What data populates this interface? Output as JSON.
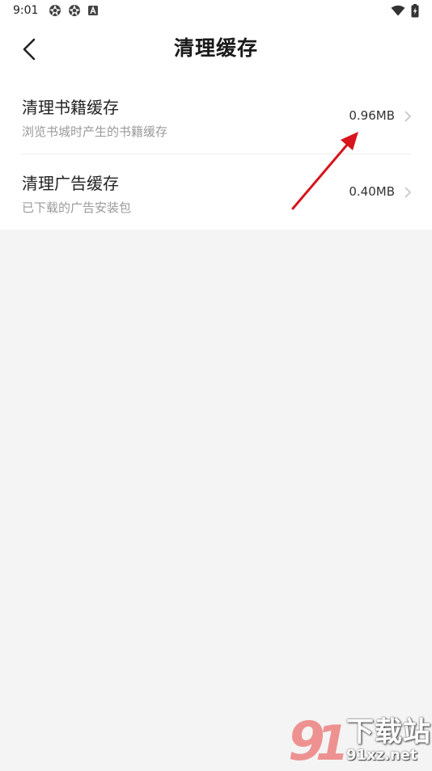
{
  "status_bar": {
    "time": "9:01",
    "icons": [
      "aperture-icon",
      "aperture-icon",
      "a-badge-icon",
      "wifi-icon",
      "battery-charging-icon"
    ]
  },
  "header": {
    "title": "清理缓存",
    "back_icon": "chevron-left-icon"
  },
  "rows": [
    {
      "title": "清理书籍缓存",
      "subtitle": "浏览书城时产生的书籍缓存",
      "value": "0.96MB"
    },
    {
      "title": "清理广告缓存",
      "subtitle": "已下载的广告安装包",
      "value": "0.40MB"
    }
  ],
  "colors": {
    "background": "#f4f4f4",
    "card": "#ffffff",
    "annotation_arrow": "#d8141c",
    "watermark": "#e8423f"
  },
  "watermark": {
    "brand": "下载站",
    "domain": "91xz.net"
  }
}
